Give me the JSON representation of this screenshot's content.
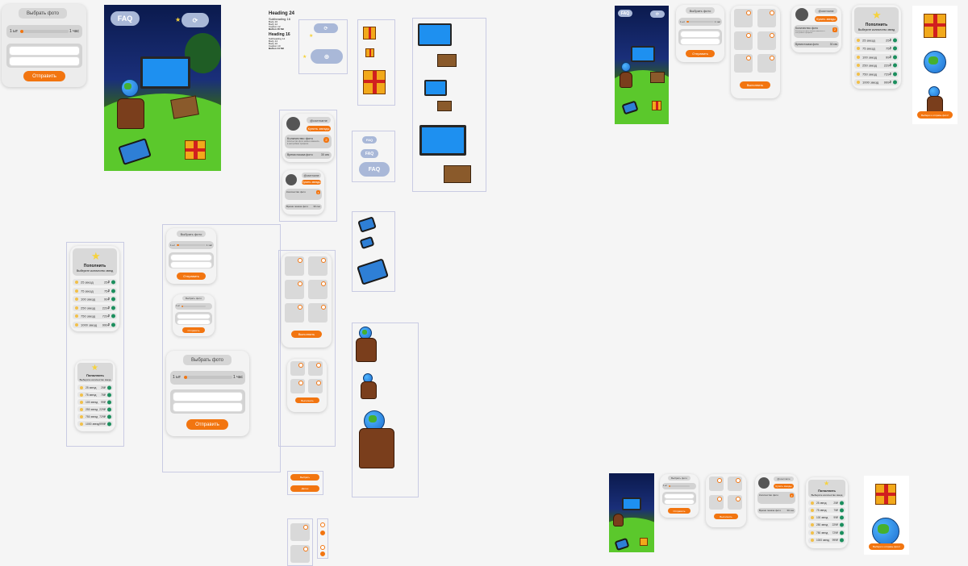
{
  "upload": {
    "title": "Выбрать фото",
    "slider_min": "1 ыт",
    "slider_max": "1 час",
    "slider_min_alt": "1 ыта",
    "submit": "Отправить",
    "field1_placeholder": "",
    "field2_placeholder": "",
    "slider_value_fraction": 0.05
  },
  "faq_label": "FAQ",
  "typography": {
    "h24": "Heading 24",
    "sub16": "Subheading 16",
    "body16": "Body 16",
    "body12": "Body 12",
    "caption": "Caption 12",
    "button": "Button 16 SB",
    "h16": "Heading 16",
    "sub14": "Subheading 14",
    "body14": "Body 14",
    "body10": "Body 10",
    "caption10": "Caption 10",
    "button14": "Button 14 SB"
  },
  "profile": {
    "badge": "@username",
    "action": "Купить звезды",
    "photos_label": "Количество фото",
    "photos_count": "2",
    "hint": "Количество фото можно изменить в настройках профиля",
    "time_label": "Время показа фото",
    "time_value": "30 сек"
  },
  "topup": {
    "title": "Пополнить",
    "subtitle": "Выберите количество звезд",
    "options": [
      {
        "label": "25 звезд",
        "price": "25₽"
      },
      {
        "label": "75 звезд",
        "price": "75₽"
      },
      {
        "label": "100 звезд",
        "price": "99₽"
      },
      {
        "label": "250 звезд",
        "price": "229₽"
      },
      {
        "label": "750 звезд",
        "price": "729₽"
      },
      {
        "label": "1000 звезд",
        "price": "999₽"
      }
    ]
  },
  "grid_screen": {
    "button": "Выполнить"
  },
  "small_buttons": {
    "b1": "Выбрать",
    "b2": "Далее"
  },
  "promo": {
    "caption": "Выбери и отправь фото!"
  },
  "colors": {
    "accent": "#f27510",
    "bg": "#f5f5f5",
    "card": "#ececec",
    "ok": "#1c8f5e"
  }
}
